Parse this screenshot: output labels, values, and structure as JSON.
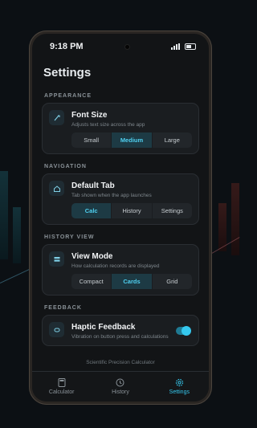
{
  "status": {
    "time": "9:18 PM"
  },
  "page": {
    "title": "Settings"
  },
  "sections": {
    "appearance": {
      "label": "APPEARANCE",
      "title": "Font Size",
      "subtitle": "Adjusts text size across the app",
      "icon": "font-size-icon",
      "options": [
        "Small",
        "Medium",
        "Large"
      ],
      "selected": "Medium"
    },
    "navigation": {
      "label": "NAVIGATION",
      "title": "Default Tab",
      "subtitle": "Tab shown when the app launches",
      "icon": "home-icon",
      "options": [
        "Calc",
        "History",
        "Settings"
      ],
      "selected": "Calc"
    },
    "history_view": {
      "label": "HISTORY VIEW",
      "title": "View Mode",
      "subtitle": "How calculation records are displayed",
      "icon": "view-mode-icon",
      "options": [
        "Compact",
        "Cards",
        "Grid"
      ],
      "selected": "Cards"
    },
    "feedback": {
      "label": "FEEDBACK",
      "title": "Haptic Feedback",
      "subtitle": "Vibration on button press and calculations",
      "icon": "vibration-icon",
      "enabled": true
    }
  },
  "footer_note": "Scientific Precision Calculator",
  "tabs": [
    {
      "label": "Calculator",
      "icon": "calculator-icon"
    },
    {
      "label": "History",
      "icon": "clock-icon"
    },
    {
      "label": "Settings",
      "icon": "gear-icon"
    }
  ],
  "active_tab": "Settings",
  "colors": {
    "accent": "#35c8ee",
    "background": "#121416",
    "card": "#1a1d20"
  }
}
